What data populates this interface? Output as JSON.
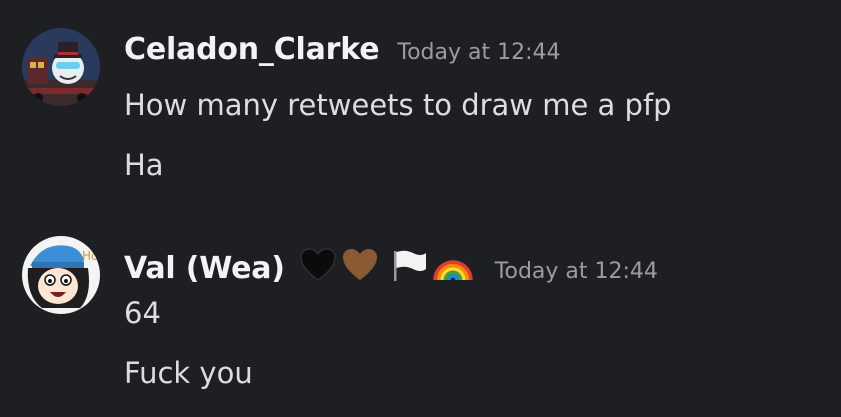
{
  "messages": [
    {
      "username": "Celadon_Clarke",
      "timestamp": "Today at 12:44",
      "lines": [
        "How many retweets to draw me a pfp",
        "Ha"
      ]
    },
    {
      "username": "Val (Wea)",
      "badges": [
        "black-heart-icon",
        "brown-heart-icon",
        "white-flag-icon",
        "rainbow-icon"
      ],
      "timestamp": "Today at 12:44",
      "lines": [
        "64",
        "Fuck you"
      ],
      "avatar_text": "Hoo"
    }
  ],
  "colors": {
    "background": "#1e1f22",
    "username": "#f2f3f5",
    "message_text": "#dbdee1",
    "timestamp": "#9a9ca3"
  }
}
